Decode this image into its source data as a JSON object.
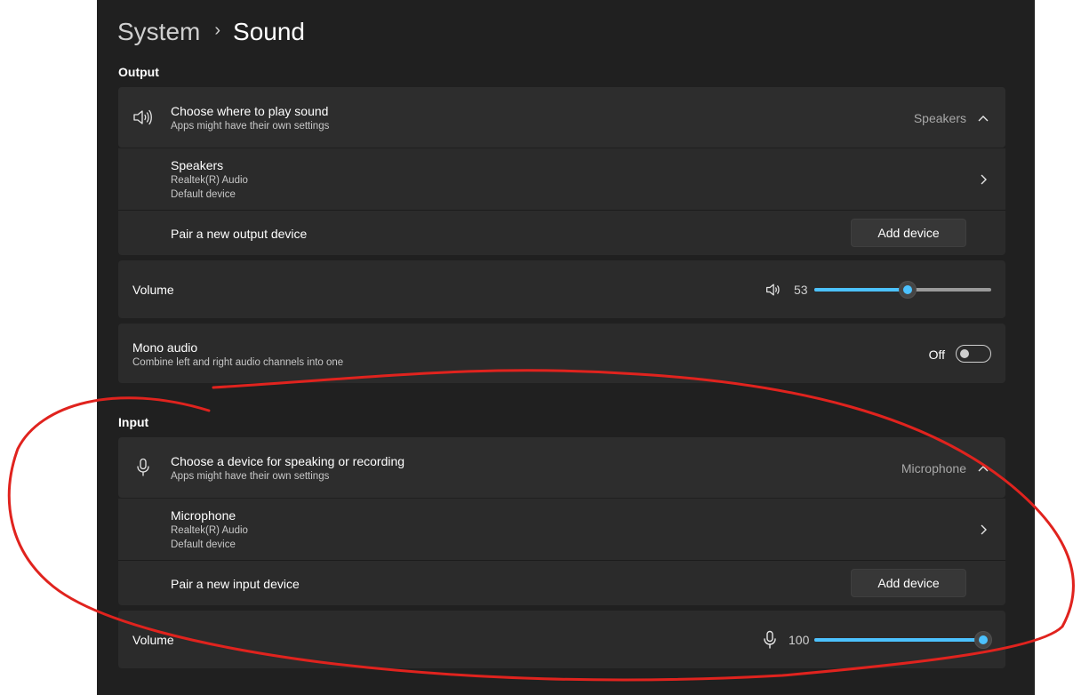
{
  "breadcrumb": {
    "parent": "System",
    "separator": "›",
    "current": "Sound"
  },
  "output": {
    "section_label": "Output",
    "choose": {
      "title": "Choose where to play sound",
      "subtitle": "Apps might have their own settings",
      "value": "Speakers",
      "icon": "speaker-icon"
    },
    "device": {
      "name": "Speakers",
      "driver": "Realtek(R) Audio",
      "status": "Default device"
    },
    "pair": {
      "label": "Pair a new output device",
      "button": "Add device"
    },
    "volume": {
      "label": "Volume",
      "value": "53",
      "level": 53,
      "icon": "speaker-icon"
    },
    "mono": {
      "title": "Mono audio",
      "subtitle": "Combine left and right audio channels into one",
      "state": "Off"
    }
  },
  "input": {
    "section_label": "Input",
    "choose": {
      "title": "Choose a device for speaking or recording",
      "subtitle": "Apps might have their own settings",
      "value": "Microphone",
      "icon": "microphone-icon"
    },
    "device": {
      "name": "Microphone",
      "driver": "Realtek(R) Audio",
      "status": "Default device"
    },
    "pair": {
      "label": "Pair a new input device",
      "button": "Add device"
    },
    "volume": {
      "label": "Volume",
      "value": "100",
      "level": 100,
      "icon": "microphone-icon"
    }
  },
  "colors": {
    "accent": "#4cc2ff",
    "background": "#202020",
    "card": "#2b2b2b",
    "annotation": "#e0231e"
  }
}
